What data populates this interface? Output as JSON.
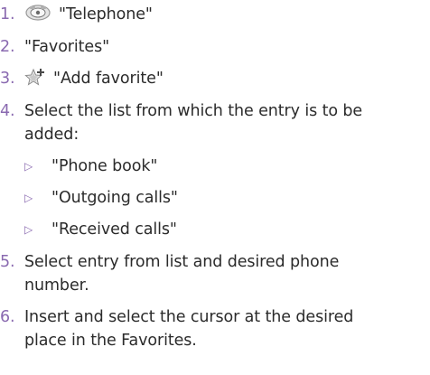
{
  "steps": [
    {
      "num": "1.",
      "text": "\"Telephone\"",
      "icon": "telephone-icon"
    },
    {
      "num": "2.",
      "text": "\"Favorites\""
    },
    {
      "num": "3.",
      "text": "\"Add favorite\"",
      "icon": "add-favorite-icon"
    },
    {
      "num": "4.",
      "line1": "Select the list from which the entry is to be",
      "line2": "added:"
    },
    {
      "num": "5.",
      "line1": "Select entry from list and desired phone",
      "line2": "number."
    },
    {
      "num": "6.",
      "line1": "Insert and select the cursor at the desired",
      "line2": "place in the Favorites."
    }
  ],
  "sublist": [
    {
      "marker": "▷",
      "text": "\"Phone book\""
    },
    {
      "marker": "▷",
      "text": "\"Outgoing calls\""
    },
    {
      "marker": "▷",
      "text": "\"Received calls\""
    }
  ],
  "colors": {
    "accent": "#8a6ab0",
    "text": "#2b2b2b"
  }
}
